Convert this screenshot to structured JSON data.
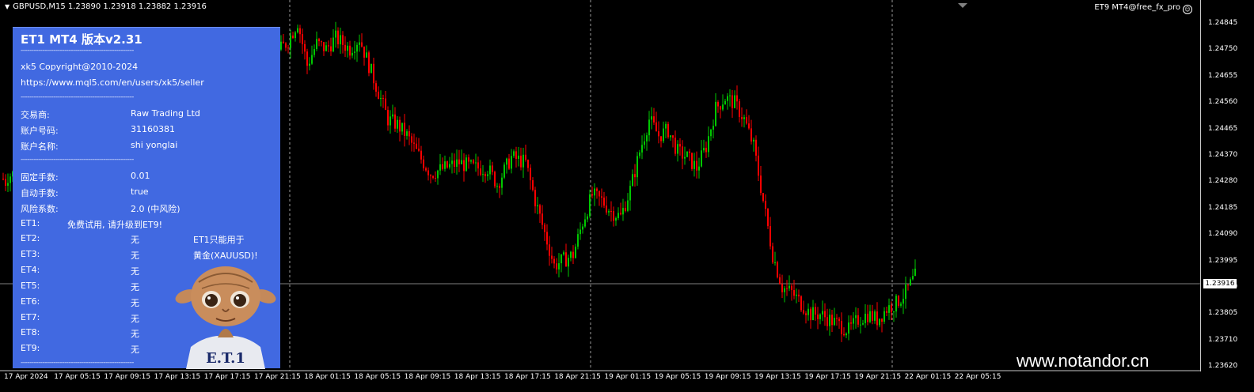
{
  "header": {
    "symbol_info": "GBPUSD,M15  1.23890 1.23918 1.23882 1.23916",
    "ea_label": "ET9 MT4@free_fx_pro"
  },
  "panel": {
    "title": "ET1 MT4 版本v2.31",
    "separator": "----------------------------------------------------",
    "copyright": "xk5 Copyright@2010-2024",
    "url": "https://www.mql5.com/en/users/xk5/seller",
    "broker_label": "交易商:",
    "broker_value": "Raw Trading Ltd",
    "account_label": "账户号码:",
    "account_value": "31160381",
    "name_label": "账户名称:",
    "name_value": "shi yonglai",
    "fixed_lots_label": "固定手数:",
    "fixed_lots_value": "0.01",
    "auto_lots_label": "自动手数:",
    "auto_lots_value": "true",
    "risk_label": "风险系数:",
    "risk_value": "2.0 (中风险)",
    "et1_label": "ET1:",
    "et1_value": "免费试用, 请升级到ET9!",
    "et_rows": [
      {
        "label": "ET2:",
        "value": "无"
      },
      {
        "label": "ET3:",
        "value": "无"
      },
      {
        "label": "ET4:",
        "value": "无"
      },
      {
        "label": "ET5:",
        "value": "无"
      },
      {
        "label": "ET6:",
        "value": "无"
      },
      {
        "label": "ET7:",
        "value": "无"
      },
      {
        "label": "ET8:",
        "value": "无"
      },
      {
        "label": "ET9:",
        "value": "无"
      }
    ],
    "note_line1": "ET1只能用于",
    "note_line2": "黄金(XAUUSD)!",
    "mascot_shirt_text": "E.T.1"
  },
  "watermark": "www.notandor.cn",
  "price_axis": [
    "1.24845",
    "1.24750",
    "1.24655",
    "1.24560",
    "1.24465",
    "1.24370",
    "1.24280",
    "1.24185",
    "1.24090",
    "1.23995",
    "1.23900",
    "1.23805",
    "1.23710",
    "1.23620"
  ],
  "current_price": "1.23916",
  "time_axis": [
    "17 Apr 2024",
    "17 Apr 05:15",
    "17 Apr 09:15",
    "17 Apr 13:15",
    "17 Apr 17:15",
    "17 Apr 21:15",
    "18 Apr 01:15",
    "18 Apr 05:15",
    "18 Apr 09:15",
    "18 Apr 13:15",
    "18 Apr 17:15",
    "18 Apr 21:15",
    "19 Apr 01:15",
    "19 Apr 05:15",
    "19 Apr 09:15",
    "19 Apr 13:15",
    "19 Apr 17:15",
    "19 Apr 21:15",
    "22 Apr 01:15",
    "22 Apr 05:15"
  ],
  "colors": {
    "bull": "#00C800",
    "bear": "#FF0000",
    "panel": "#4169E1",
    "background": "#000000"
  },
  "chart_data": {
    "type": "candlestick",
    "symbol": "GBPUSD",
    "timeframe": "M15",
    "ylim": [
      1.2358,
      1.249
    ],
    "x_ticks": [
      "17 Apr 2024",
      "17 Apr 05:15",
      "17 Apr 09:15",
      "17 Apr 13:15",
      "17 Apr 17:15",
      "17 Apr 21:15",
      "18 Apr 01:15",
      "18 Apr 05:15",
      "18 Apr 09:15",
      "18 Apr 13:15",
      "18 Apr 17:15",
      "18 Apr 21:15",
      "19 Apr 01:15",
      "19 Apr 05:15",
      "19 Apr 09:15",
      "19 Apr 13:15",
      "19 Apr 17:15",
      "19 Apr 21:15",
      "22 Apr 01:15",
      "22 Apr 05:15"
    ],
    "close_path": [
      [
        0,
        1.2428
      ],
      [
        1,
        1.2427
      ],
      [
        2,
        1.2429
      ],
      [
        60,
        1.2452
      ],
      [
        62,
        1.2448
      ],
      [
        68,
        1.2455
      ],
      [
        72,
        1.2448
      ],
      [
        76,
        1.2446
      ],
      [
        80,
        1.2448
      ],
      [
        90,
        1.2458
      ],
      [
        96,
        1.2462
      ],
      [
        100,
        1.2466
      ],
      [
        104,
        1.2468
      ],
      [
        110,
        1.2472
      ],
      [
        116,
        1.2475
      ],
      [
        120,
        1.2479
      ],
      [
        124,
        1.2486
      ],
      [
        128,
        1.247
      ],
      [
        132,
        1.2478
      ],
      [
        136,
        1.2476
      ],
      [
        140,
        1.248
      ],
      [
        146,
        1.2476
      ],
      [
        150,
        1.248
      ],
      [
        154,
        1.247
      ],
      [
        158,
        1.246
      ],
      [
        162,
        1.245
      ],
      [
        166,
        1.2448
      ],
      [
        170,
        1.2444
      ],
      [
        174,
        1.2438
      ],
      [
        180,
        1.243
      ],
      [
        186,
        1.2432
      ],
      [
        192,
        1.2434
      ],
      [
        198,
        1.2432
      ],
      [
        204,
        1.2432
      ],
      [
        208,
        1.2426
      ],
      [
        214,
        1.2436
      ],
      [
        220,
        1.2434
      ],
      [
        224,
        1.242
      ],
      [
        228,
        1.2408
      ],
      [
        232,
        1.2396
      ],
      [
        236,
        1.2398
      ],
      [
        240,
        1.24
      ],
      [
        244,
        1.2412
      ],
      [
        248,
        1.2422
      ],
      [
        252,
        1.242
      ],
      [
        256,
        1.2416
      ],
      [
        260,
        1.2414
      ],
      [
        264,
        1.2424
      ],
      [
        268,
        1.2438
      ],
      [
        272,
        1.245
      ],
      [
        276,
        1.2444
      ],
      [
        280,
        1.2446
      ],
      [
        284,
        1.2438
      ],
      [
        288,
        1.2436
      ],
      [
        292,
        1.2432
      ],
      [
        296,
        1.244
      ],
      [
        300,
        1.2454
      ],
      [
        304,
        1.2458
      ],
      [
        308,
        1.2456
      ],
      [
        312,
        1.245
      ],
      [
        316,
        1.244
      ],
      [
        320,
        1.242
      ],
      [
        324,
        1.24
      ],
      [
        328,
        1.2388
      ],
      [
        332,
        1.2386
      ],
      [
        336,
        1.2382
      ],
      [
        340,
        1.2378
      ],
      [
        344,
        1.2378
      ],
      [
        348,
        1.2376
      ],
      [
        352,
        1.2374
      ],
      [
        356,
        1.2372
      ],
      [
        360,
        1.2376
      ],
      [
        364,
        1.2378
      ],
      [
        368,
        1.2376
      ],
      [
        372,
        1.238
      ],
      [
        376,
        1.2382
      ],
      [
        380,
        1.2386
      ],
      [
        384,
        1.2392
      ]
    ]
  }
}
